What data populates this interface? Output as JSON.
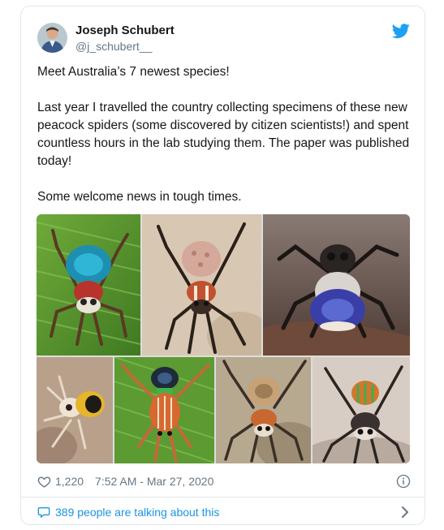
{
  "author": {
    "name": "Joseph Schubert",
    "handle": "@j_schubert__",
    "avatar_icon": "profile-photo"
  },
  "brand": {
    "icon": "twitter-bird-icon",
    "color": "#1da1f2"
  },
  "tweet": {
    "paragraphs": [
      "Meet Australia’s 7 newest species!",
      "Last year I travelled the country collecting specimens of these new peacock spiders (some discovered by citizen scientists!) and spent countless hours in the lab studying them. The paper was published today!",
      "Some welcome news in tough times."
    ]
  },
  "media": {
    "photo_count": 7,
    "subjects": [
      "peacock-spider"
    ]
  },
  "meta": {
    "likes": "1,220",
    "timestamp": "7:52 AM - Mar 27, 2020",
    "like_icon": "heart-icon",
    "info_icon": "info-icon"
  },
  "conversation": {
    "label": "389 people are talking about this",
    "icon": "comment-bubble-icon",
    "chevron_icon": "chevron-right-icon",
    "color": "#1b95e0"
  }
}
